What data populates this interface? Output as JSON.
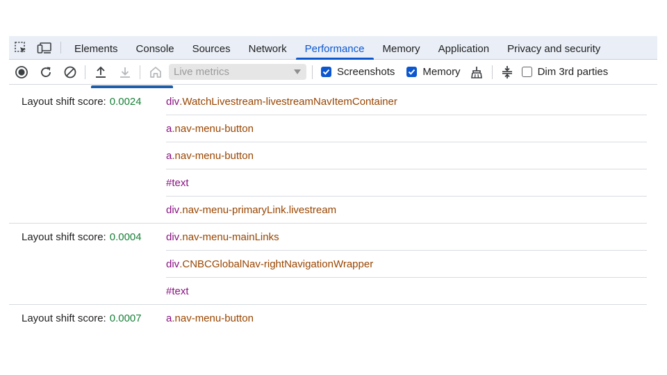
{
  "tabs": [
    {
      "label": "Elements",
      "active": false
    },
    {
      "label": "Console",
      "active": false
    },
    {
      "label": "Sources",
      "active": false
    },
    {
      "label": "Network",
      "active": false
    },
    {
      "label": "Performance",
      "active": true
    },
    {
      "label": "Memory",
      "active": false
    },
    {
      "label": "Application",
      "active": false
    },
    {
      "label": "Privacy and security",
      "active": false
    }
  ],
  "toolbar": {
    "select_value": "Live metrics",
    "screenshots_label": "Screenshots",
    "screenshots_checked": true,
    "memory_label": "Memory",
    "memory_checked": true,
    "dim_label": "Dim 3rd parties",
    "dim_checked": false
  },
  "shifts": [
    {
      "label": "Layout shift score:",
      "score": "0.0024",
      "nodes": [
        {
          "tag": "div",
          "rest": ".WatchLivestream-livestreamNavItemContainer"
        },
        {
          "tag": "a",
          "rest": ".nav-menu-button"
        },
        {
          "tag": "a",
          "rest": ".nav-menu-button"
        },
        {
          "tag": "#text",
          "rest": ""
        },
        {
          "tag": "div",
          "rest": ".nav-menu-primaryLink.livestream"
        }
      ]
    },
    {
      "label": "Layout shift score:",
      "score": "0.0004",
      "nodes": [
        {
          "tag": "div",
          "rest": ".nav-menu-mainLinks"
        },
        {
          "tag": "div",
          "rest": ".CNBCGlobalNav-rightNavigationWrapper"
        },
        {
          "tag": "#text",
          "rest": ""
        }
      ]
    },
    {
      "label": "Layout shift score:",
      "score": "0.0007",
      "nodes": [
        {
          "tag": "a",
          "rest": ".nav-menu-button"
        }
      ]
    }
  ],
  "colors": {
    "accent": "#0b57d0",
    "score": "#188038",
    "node_tag": "#881280",
    "node_class": "#994500"
  }
}
